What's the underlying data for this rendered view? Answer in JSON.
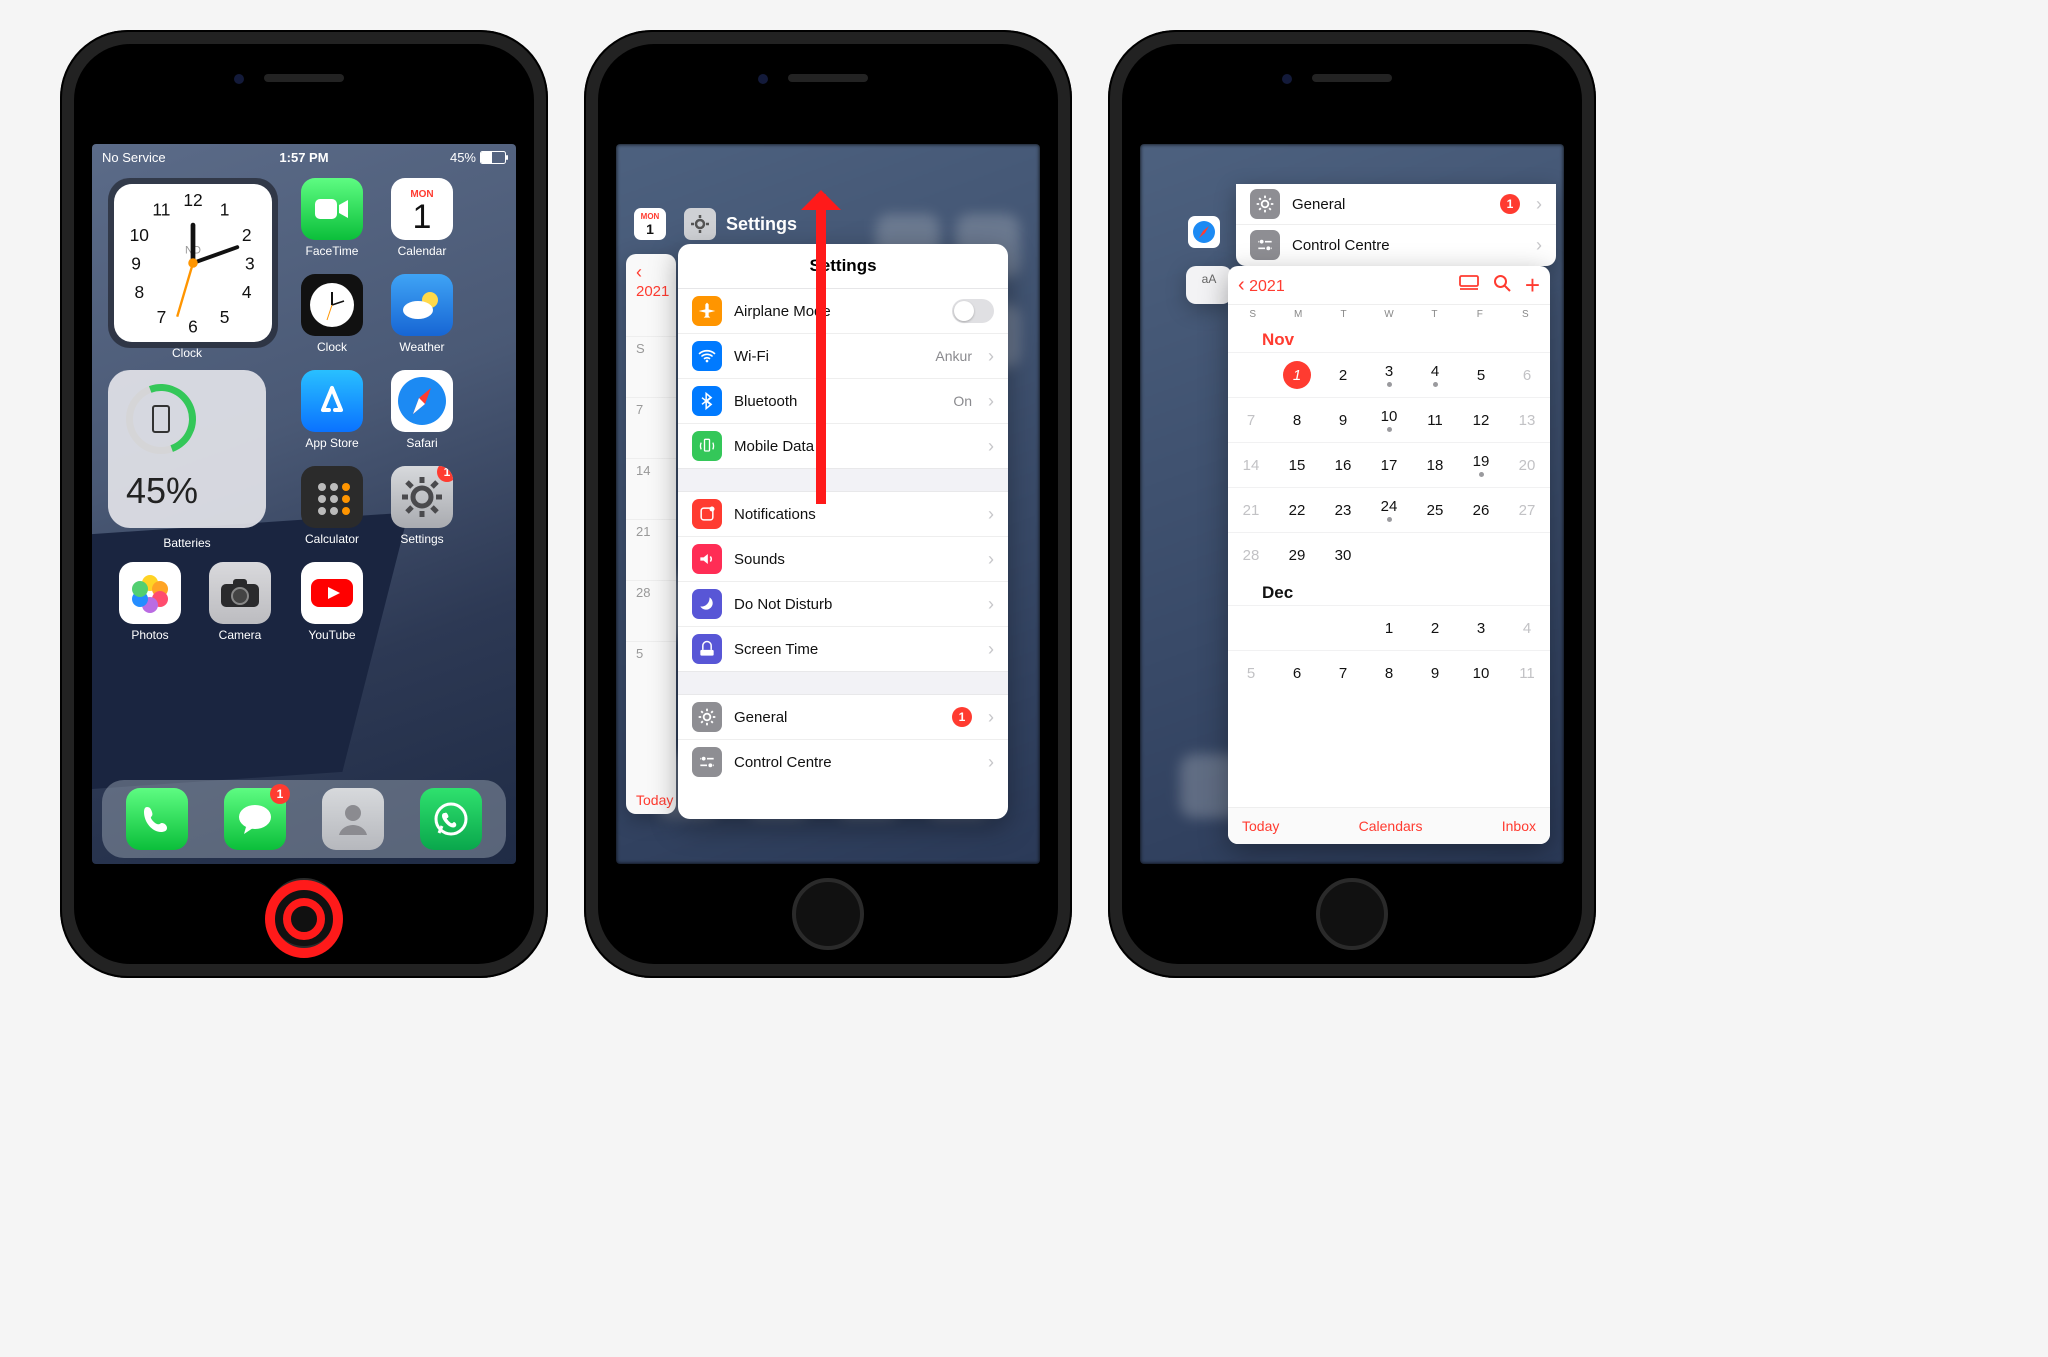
{
  "phone1": {
    "status": {
      "left": "No Service",
      "time": "1:57 PM",
      "battery_pct": "45%"
    },
    "widgets": {
      "clock_label": "Clock",
      "batteries_label": "Batteries",
      "batteries_pct": "45%",
      "brand": "ND"
    },
    "apps": {
      "facetime": "FaceTime",
      "calendar": "Calendar",
      "cal_dow": "MON",
      "cal_num": "1",
      "clock": "Clock",
      "weather": "Weather",
      "appstore": "App Store",
      "safari": "Safari",
      "calculator": "Calculator",
      "settings": "Settings",
      "settings_badge": "1",
      "photos": "Photos",
      "camera": "Camera",
      "youtube": "YouTube"
    },
    "dock": {
      "phone": "Phone",
      "messages": "Messages",
      "messages_badge": "1",
      "contacts": "Contacts",
      "whatsapp": "WhatsApp"
    }
  },
  "phone2": {
    "calendar_peek": {
      "year": "2021",
      "today": "Today",
      "days": [
        "5",
        "7",
        "14",
        "21",
        "28"
      ]
    },
    "header": {
      "app": "Settings",
      "icon": "settings"
    },
    "settings_card": {
      "title": "Settings",
      "rows": [
        {
          "icon": "airplane",
          "color": "#ff9500",
          "label": "Airplane Mode",
          "toggle": true
        },
        {
          "icon": "wifi",
          "color": "#007aff",
          "label": "Wi-Fi",
          "value": "Ankur",
          "chev": true
        },
        {
          "icon": "bt",
          "color": "#007aff",
          "label": "Bluetooth",
          "value": "On",
          "chev": true
        },
        {
          "icon": "cell",
          "color": "#34c759",
          "label": "Mobile Data",
          "chev": true
        }
      ],
      "rows2": [
        {
          "icon": "notif",
          "color": "#ff3b30",
          "label": "Notifications",
          "chev": true
        },
        {
          "icon": "sound",
          "color": "#ff2d55",
          "label": "Sounds",
          "chev": true
        },
        {
          "icon": "dnd",
          "color": "#5856d6",
          "label": "Do Not Disturb",
          "chev": true
        },
        {
          "icon": "screentime",
          "color": "#5856d6",
          "label": "Screen Time",
          "chev": true
        }
      ],
      "rows3": [
        {
          "icon": "gear",
          "color": "#8e8e93",
          "label": "General",
          "badge": "1",
          "chev": true
        },
        {
          "icon": "cc",
          "color": "#8e8e93",
          "label": "Control Centre",
          "chev": true
        }
      ]
    }
  },
  "phone3": {
    "settings_peek": [
      {
        "icon": "gear",
        "color": "#8e8e93",
        "label": "General",
        "badge": "1"
      },
      {
        "icon": "cc",
        "color": "#8e8e93",
        "label": "Control Centre"
      }
    ],
    "safari_peek": "aA",
    "cal": {
      "year": "2021",
      "weekdays": [
        "S",
        "M",
        "T",
        "W",
        "T",
        "F",
        "S"
      ],
      "month1": "Nov",
      "month1_days": [
        {
          "n": "",
          "d": 0
        },
        {
          "n": "1",
          "d": 0,
          "today": true
        },
        {
          "n": "2",
          "d": 0
        },
        {
          "n": "3",
          "d": 0,
          "dot": true
        },
        {
          "n": "4",
          "d": 0,
          "dot": true
        },
        {
          "n": "5",
          "d": 0
        },
        {
          "n": "6",
          "d": 1
        },
        {
          "n": "7",
          "d": 1
        },
        {
          "n": "8",
          "d": 0
        },
        {
          "n": "9",
          "d": 0
        },
        {
          "n": "10",
          "d": 0,
          "dot": true
        },
        {
          "n": "11",
          "d": 0
        },
        {
          "n": "12",
          "d": 0
        },
        {
          "n": "13",
          "d": 1
        },
        {
          "n": "14",
          "d": 1
        },
        {
          "n": "15",
          "d": 0
        },
        {
          "n": "16",
          "d": 0
        },
        {
          "n": "17",
          "d": 0
        },
        {
          "n": "18",
          "d": 0
        },
        {
          "n": "19",
          "d": 0,
          "dot": true
        },
        {
          "n": "20",
          "d": 1
        },
        {
          "n": "21",
          "d": 1
        },
        {
          "n": "22",
          "d": 0
        },
        {
          "n": "23",
          "d": 0
        },
        {
          "n": "24",
          "d": 0,
          "dot": true
        },
        {
          "n": "25",
          "d": 0
        },
        {
          "n": "26",
          "d": 0
        },
        {
          "n": "27",
          "d": 1
        },
        {
          "n": "28",
          "d": 1
        },
        {
          "n": "29",
          "d": 0
        },
        {
          "n": "30",
          "d": 0
        },
        {
          "n": "",
          "d": 0
        },
        {
          "n": "",
          "d": 0
        },
        {
          "n": "",
          "d": 0
        },
        {
          "n": "",
          "d": 0
        }
      ],
      "month2": "Dec",
      "month2_row1": [
        {
          "n": ""
        },
        {
          "n": ""
        },
        {
          "n": ""
        },
        {
          "n": "1"
        },
        {
          "n": "2"
        },
        {
          "n": "3"
        },
        {
          "n": "4",
          "d": 1
        }
      ],
      "month2_row2": [
        {
          "n": "5",
          "d": 1
        },
        {
          "n": "6"
        },
        {
          "n": "7"
        },
        {
          "n": "8"
        },
        {
          "n": "9"
        },
        {
          "n": "10"
        },
        {
          "n": "11",
          "d": 1
        }
      ],
      "footer": {
        "today": "Today",
        "calendars": "Calendars",
        "inbox": "Inbox"
      }
    }
  }
}
